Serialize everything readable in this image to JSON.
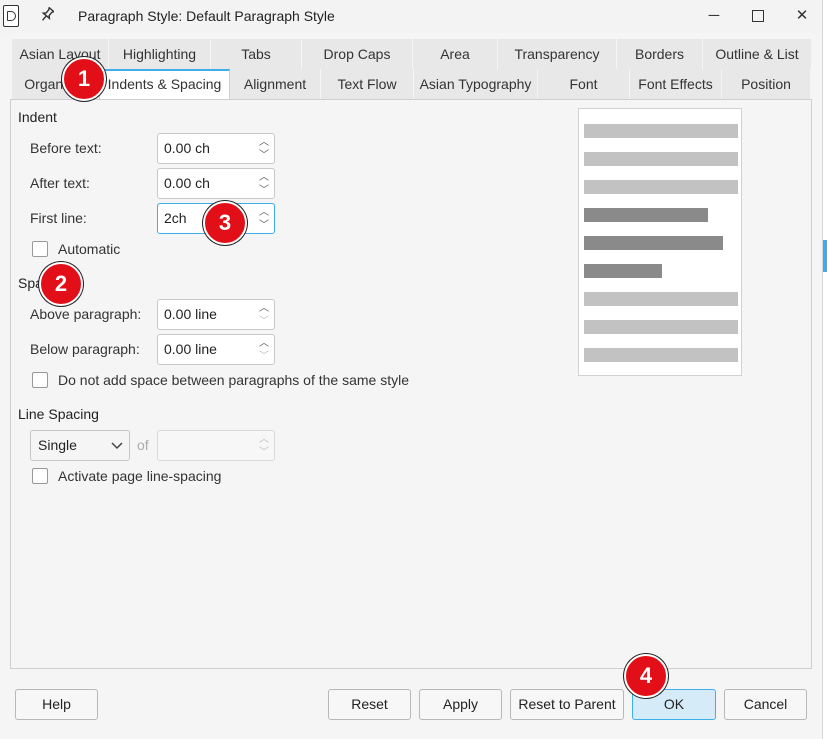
{
  "window": {
    "title": "Paragraph Style: Default Paragraph Style",
    "minimize": "─",
    "close": "✕"
  },
  "tabs_row1": [
    "Asian Layout",
    "Highlighting",
    "Tabs",
    "Drop Caps",
    "Area",
    "Transparency",
    "Borders",
    "Outline & List"
  ],
  "tabs_row2": [
    "Organizer",
    "Indents & Spacing",
    "Alignment",
    "Text Flow",
    "Asian Typography",
    "Font",
    "Font Effects",
    "Position"
  ],
  "active_tab": "Indents & Spacing",
  "indent": {
    "title": "Indent",
    "before_label": "Before text:",
    "before_value": "0.00 ch",
    "after_label": "After text:",
    "after_value": "0.00 ch",
    "first_label": "First line:",
    "first_value": "2ch",
    "automatic_label": "Automatic"
  },
  "spacing": {
    "title": "Spacing",
    "above_label": "Above paragraph:",
    "above_value": "0.00 line",
    "below_label": "Below paragraph:",
    "below_value": "0.00 line",
    "no_space_label": "Do not add space between paragraphs of the same style"
  },
  "line_spacing": {
    "title": "Line Spacing",
    "selected": "Single",
    "of_label": "of",
    "activate_label": "Activate page line-spacing"
  },
  "buttons": {
    "help": "Help",
    "reset": "Reset",
    "apply": "Apply",
    "reset_parent": "Reset to Parent",
    "ok": "OK",
    "cancel": "Cancel"
  },
  "markers": [
    "1",
    "2",
    "3",
    "4"
  ],
  "colors": {
    "accent": "#3daee9",
    "marker": "#e20f18",
    "preview_light": "#c2c2c2",
    "preview_dark": "#8a8a8a"
  }
}
